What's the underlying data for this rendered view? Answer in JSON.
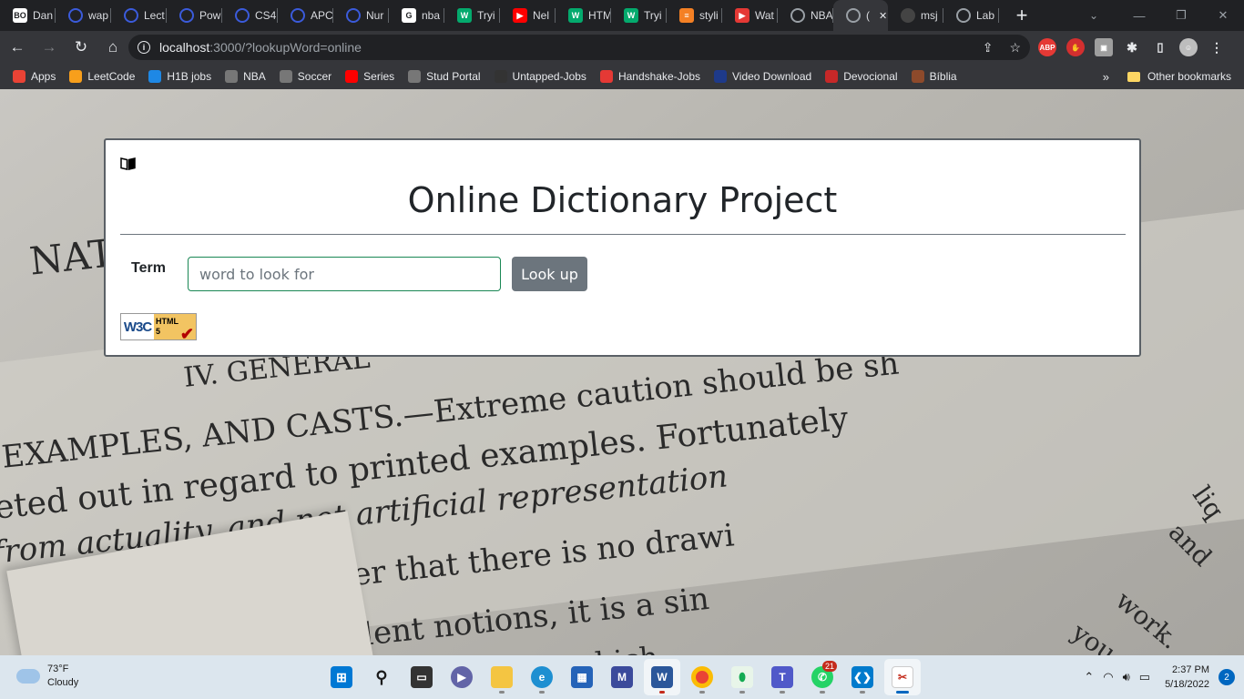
{
  "browser": {
    "tabs": [
      {
        "title": "Dan",
        "icon": "BO",
        "color": "#ffffff"
      },
      {
        "title": "wap",
        "icon": "globe",
        "color": "#3b5bdb"
      },
      {
        "title": "Lect",
        "icon": "globe",
        "color": "#3b5bdb"
      },
      {
        "title": "Pow",
        "icon": "globe",
        "color": "#3b5bdb"
      },
      {
        "title": "CS4",
        "icon": "globe",
        "color": "#3b5bdb"
      },
      {
        "title": "APC",
        "icon": "globe",
        "color": "#3b5bdb"
      },
      {
        "title": "Nur",
        "icon": "globe",
        "color": "#3b5bdb"
      },
      {
        "title": "nba",
        "icon": "G",
        "color": "#ffffff"
      },
      {
        "title": "Tryi",
        "icon": "W",
        "color": "#04aa6d"
      },
      {
        "title": "Nel",
        "icon": "▶",
        "color": "#ff0000"
      },
      {
        "title": "HTM",
        "icon": "W",
        "color": "#04aa6d"
      },
      {
        "title": "Tryi",
        "icon": "W",
        "color": "#04aa6d"
      },
      {
        "title": "styli",
        "icon": "≡",
        "color": "#f48024"
      },
      {
        "title": "Wat",
        "icon": "▶",
        "color": "#e53935"
      },
      {
        "title": "NBA",
        "icon": "globe",
        "color": "#9aa0a6"
      },
      {
        "title": "(",
        "icon": "globe",
        "color": "#9aa0a6"
      },
      {
        "title": "msj",
        "icon": "gh",
        "color": "#444444"
      },
      {
        "title": "Lab",
        "icon": "globe",
        "color": "#9aa0a6"
      }
    ],
    "active_tab_index": 15,
    "new_tab_symbol": "+",
    "url_host": "localhost",
    "url_rest": ":3000/?lookupWord=online",
    "bookmarks": [
      {
        "label": "Apps",
        "color": "#ea4335"
      },
      {
        "label": "LeetCode",
        "color": "#f89f1b"
      },
      {
        "label": "H1B jobs",
        "color": "#1e88e5"
      },
      {
        "label": "NBA",
        "color": "#777777"
      },
      {
        "label": "Soccer",
        "color": "#777777"
      },
      {
        "label": "Series",
        "color": "#ff0000"
      },
      {
        "label": "Stud Portal",
        "color": "#777777"
      },
      {
        "label": "Untapped-Jobs",
        "color": "#333333"
      },
      {
        "label": "Handshake-Jobs",
        "color": "#e53935"
      },
      {
        "label": "Video Download",
        "color": "#1e3a8a"
      },
      {
        "label": "Devocional",
        "color": "#c62828"
      },
      {
        "label": "Bíblia",
        "color": "#8d4a2b"
      }
    ],
    "bookmarks_more": "»",
    "other_bookmarks": "Other bookmarks"
  },
  "page": {
    "title": "Online Dictionary Project",
    "term_label": "Term",
    "input_placeholder": "word to look for",
    "input_value": "",
    "button_label": "Look up",
    "badge_w3c": "W3C",
    "badge_html": "HTML",
    "badge_version": "5",
    "accent_input_border": "#198754",
    "button_color": "#6c757d"
  },
  "background_text": {
    "line1": "NAT",
    "line2": "IV. GENERAL",
    "line3": "EXAMPLES, AND CASTS.—Extreme caution should be sh",
    "line4": "eted out in regard to printed examples.   Fortunately",
    "line5": "from actuality, and not artificial representation",
    "line6": "view to consider that there is no drawi",
    "line7": "prevalent notions, it is a sin",
    "line8": "diagram which",
    "side1": "liq",
    "side2": "and",
    "side3": "work.",
    "side4": "you"
  },
  "taskbar": {
    "temperature": "73°F",
    "condition": "Cloudy",
    "time": "2:37 PM",
    "date": "5/18/2022",
    "notification_count": "2",
    "whatsapp_badge": "21"
  }
}
